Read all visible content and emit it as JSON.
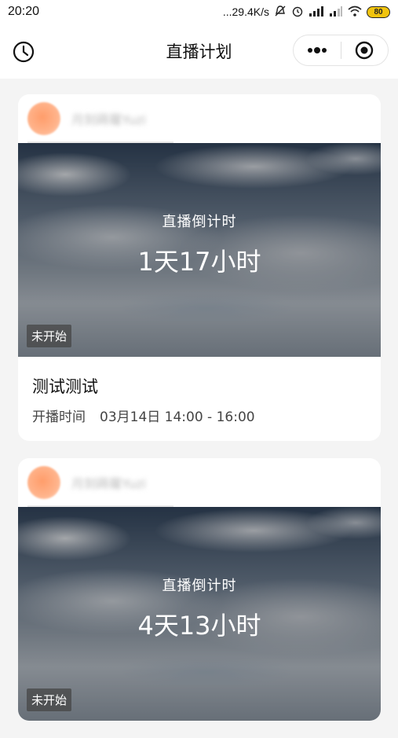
{
  "status": {
    "time": "20:20",
    "network_speed": "...29.4K/s",
    "battery": "80"
  },
  "nav": {
    "title": "直播计划"
  },
  "cards": [
    {
      "author": "月刻蒔蘿Yuzi",
      "countdown_label": "直播倒计时",
      "countdown_value": "1天17小时",
      "state": "未开始",
      "title": "测试测试",
      "time_label": "开播时间",
      "time_value": "03月14日 14:00 - 16:00"
    },
    {
      "author": "月刻蒔蘿Yuzi",
      "countdown_label": "直播倒计时",
      "countdown_value": "4天13小时",
      "state": "未开始"
    }
  ]
}
